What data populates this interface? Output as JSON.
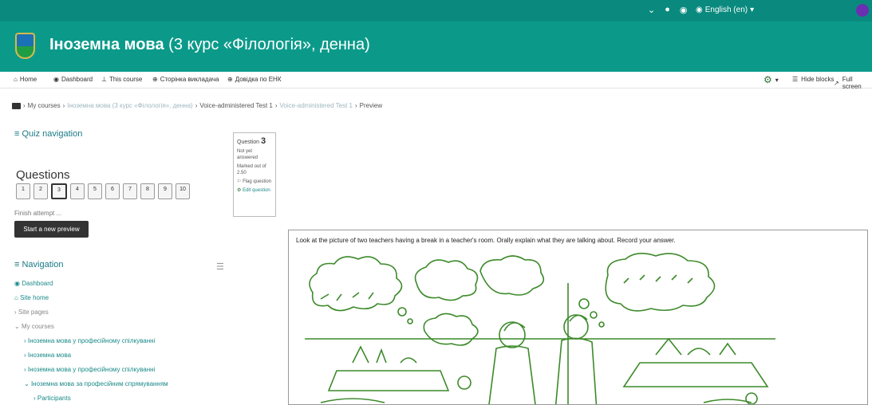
{
  "topbar": {
    "language": "English (en)",
    "icons": [
      "chevron-down-icon",
      "bell-icon",
      "chat-icon",
      "globe-icon"
    ]
  },
  "header": {
    "title_main": "Іноземна мова",
    "title_sub": "(3 курс «Філологія», денна)"
  },
  "navbar": {
    "items": [
      {
        "label": "Home",
        "icon": "home-icon"
      },
      {
        "label": "Dashboard",
        "icon": "dashboard-icon"
      },
      {
        "label": "This course",
        "icon": "sitemap-icon"
      },
      {
        "label": "Сторінка викладача",
        "icon": "plus-circle-icon"
      },
      {
        "label": "Довідка по ЕНК",
        "icon": "plus-circle-icon"
      }
    ],
    "hide_blocks": "Hide blocks",
    "full_screen": "Full screen"
  },
  "breadcrumb": {
    "items": [
      "My courses",
      "Іноземна мова (3 курс «Філологія», денна)",
      "Voice-administered Test 1",
      "Voice-administered Test 1",
      "Preview"
    ]
  },
  "quiz_nav": {
    "header": "Quiz navigation",
    "questions_title": "Questions",
    "numbers": [
      "1",
      "2",
      "3",
      "4",
      "5",
      "6",
      "7",
      "8",
      "9",
      "10"
    ],
    "current": "3",
    "finish": "Finish attempt ...",
    "start_button": "Start a new preview"
  },
  "question_info": {
    "label": "Question",
    "number": "3",
    "status": "Not yet answered",
    "marked": "Marked out of 2.50",
    "flag": "Flag question",
    "edit": "Edit question"
  },
  "navigation": {
    "header": "Navigation",
    "items": [
      "Dashboard",
      "Site home",
      "Site pages",
      "My courses",
      "Іноземна мова у професійному спілкуванні",
      "Іноземна мова",
      "Іноземна мова у професійному спілкуванні",
      "Іноземна мова за професійним спрямуванням",
      "Participants"
    ]
  },
  "question": {
    "text": "Look at the picture of two teachers having a break in a teacher's room. Orally explain what they are talking about. Record your answer."
  },
  "colors": {
    "topbar": "#0a8a7e",
    "header": "#0b9a8a",
    "link": "#1a8a88",
    "drawing": "#3c8a2a"
  }
}
